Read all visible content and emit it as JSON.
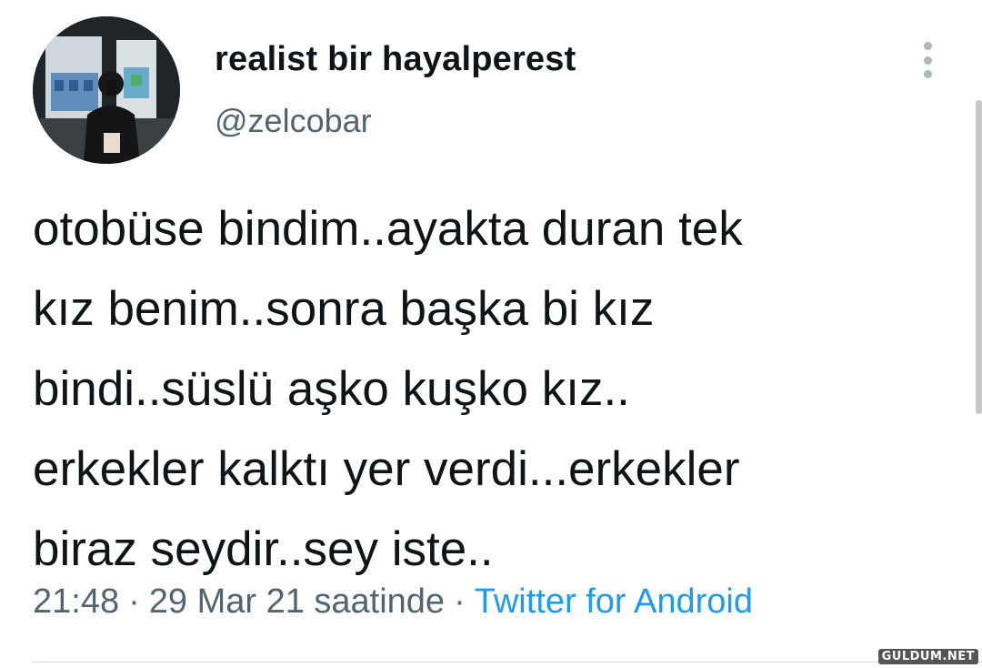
{
  "user": {
    "display_name": "realist bir hayalperest",
    "handle": "@zelcobar",
    "avatar_icon": "profile-photo"
  },
  "more_icon": "more-options-icon",
  "tweet": {
    "lines": [
      "otobüse bindim..ayakta duran tek",
      "kız benim..sonra başka bi kız",
      "bindi..süslü aşko kuşko kız..",
      "erkekler kalktı yer verdi...erkekler",
      "biraz seydir..sey iste.."
    ]
  },
  "meta": {
    "time": "21:48",
    "separator": "·",
    "date": "29 Mar 21 saatinde",
    "source": "Twitter for Android"
  },
  "watermark": "GULDUM.NET",
  "colors": {
    "text": "#0f1419",
    "secondary": "#536471",
    "accent": "#1d9bf0",
    "divider": "#cfd9de"
  }
}
